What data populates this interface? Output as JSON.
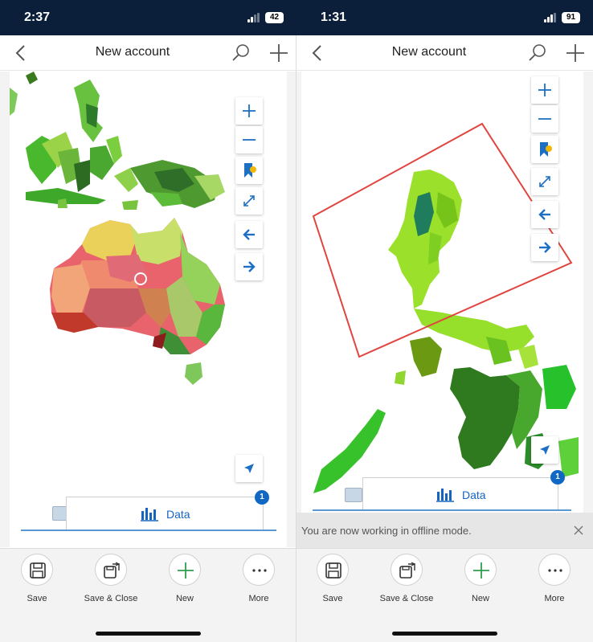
{
  "colors": {
    "status_bg": "#0b1f3b",
    "accent_blue": "#1565c0",
    "badge_blue": "#1168c4",
    "add_green": "#2e9e4f",
    "selection_red": "#e0453f"
  },
  "left": {
    "status": {
      "time": "2:37",
      "battery": "42"
    },
    "header": {
      "title": "New account",
      "back_icon": "chevron-left-icon",
      "search_icon": "search-icon",
      "add_icon": "plus-icon"
    },
    "map": {
      "region": "Australia and surrounding region",
      "controls": [
        "zoom-in-icon",
        "zoom-out-icon",
        "bookmark-icon",
        "expand-icon",
        "back-arrow-icon",
        "forward-arrow-icon"
      ],
      "locate_icon": "locate-icon"
    },
    "data_panel": {
      "label": "Data",
      "badge": "1",
      "icon": "bar-chart-icon"
    },
    "commands": [
      {
        "label": "Save",
        "icon": "save-icon"
      },
      {
        "label": "Save & Close",
        "icon": "save-close-icon"
      },
      {
        "label": "New",
        "icon": "plus-icon"
      },
      {
        "label": "More",
        "icon": "ellipsis-icon"
      }
    ]
  },
  "right": {
    "status": {
      "time": "1:31",
      "battery": "91"
    },
    "header": {
      "title": "New account",
      "back_icon": "chevron-left-icon",
      "search_icon": "search-icon",
      "add_icon": "plus-icon"
    },
    "map": {
      "region": "Philippines",
      "controls": [
        "zoom-in-icon",
        "zoom-out-icon",
        "bookmark-icon",
        "expand-icon",
        "back-arrow-icon",
        "forward-arrow-icon"
      ],
      "locate_icon": "locate-icon"
    },
    "data_panel": {
      "label": "Data",
      "badge": "1",
      "icon": "bar-chart-icon"
    },
    "offline_message": "You are now working in offline mode.",
    "commands": [
      {
        "label": "Save",
        "icon": "save-icon"
      },
      {
        "label": "Save & Close",
        "icon": "save-close-icon"
      },
      {
        "label": "New",
        "icon": "plus-icon"
      },
      {
        "label": "More",
        "icon": "ellipsis-icon"
      }
    ]
  }
}
